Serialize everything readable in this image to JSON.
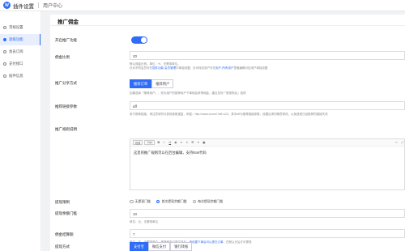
{
  "app": {
    "logo_text": "W",
    "title": "插件设置",
    "subtitle": "用户中心"
  },
  "sidebar": {
    "items": [
      {
        "label": "常规设置",
        "icon": "gear-icon",
        "active": false
      },
      {
        "label": "高级功能",
        "icon": "star-icon",
        "active": true
      },
      {
        "label": "会员订阅",
        "icon": "crown-icon",
        "active": false
      },
      {
        "label": "支付接口",
        "icon": "card-icon",
        "active": false
      },
      {
        "label": "插件信息",
        "icon": "info-icon",
        "active": false
      }
    ]
  },
  "page": {
    "title": "推广佣金"
  },
  "form": {
    "enable_label": "开启推广功能",
    "enable_on": true,
    "ratio_label": "佣金比例",
    "ratio_value": "20",
    "ratio_hint_1": "默认佣金比例，单位：%，无需带单位。",
    "ratio_hint_2_a": "针对不同会员可在",
    "ratio_hint_2_link_1": "插件功能-会员管理",
    "ratio_hint_2_b": "中单独设置；针对特定用户可在",
    "ratio_hint_2_link_2": "用户-所有用户",
    "ratio_hint_2_c": "里面编辑对应用户单独设置",
    "share_label": "推广分享方式",
    "share_options": [
      "推荐订单",
      "推荐用户"
    ],
    "share_active": 0,
    "share_hint": "如果选择「推荐用户」，则为用户的推荐用户下单就会获得佣金，建议关闭「登录购买」选项",
    "param_label": "推荐链接参数",
    "param_value": "aff",
    "param_hint": "用于推荐链接，请注意请勿与其他参数重复，例如：http://www.a.com/?aff=123，其中aff为推荐链接参数，设置后请勿随意修改，以免造成已经推荐的链接失效",
    "desc_label": "推广规则说明",
    "editor_format": "段落",
    "editor_size": "14px",
    "editor_content": "这里的推广规则可以在后台编辑，支持html代码",
    "withdraw_label": "提现限制",
    "withdraw_options": [
      "无提现门槛",
      "首次提现余额门槛",
      "每次提现余额门槛"
    ],
    "withdraw_selected": 1,
    "min_label": "提现余额门槛",
    "min_value": "10",
    "min_hint": "单位：元，无需带单位",
    "fee_label": "佣金结算期",
    "fee_value": "7",
    "fee_hint_a": "单位：天，无需带单位，推荐佣金订单生效后，",
    "fee_hint_link": "请设置下单后可以提交订单",
    "fee_hint_b": "，在默认天后才可提现",
    "method_label": "提现方式",
    "method_options": [
      "支付宝",
      "微信支付",
      "银行转账"
    ],
    "method_active": 0
  },
  "colors": {
    "accent": "#2f6df6",
    "background": "#f0f2f5"
  }
}
